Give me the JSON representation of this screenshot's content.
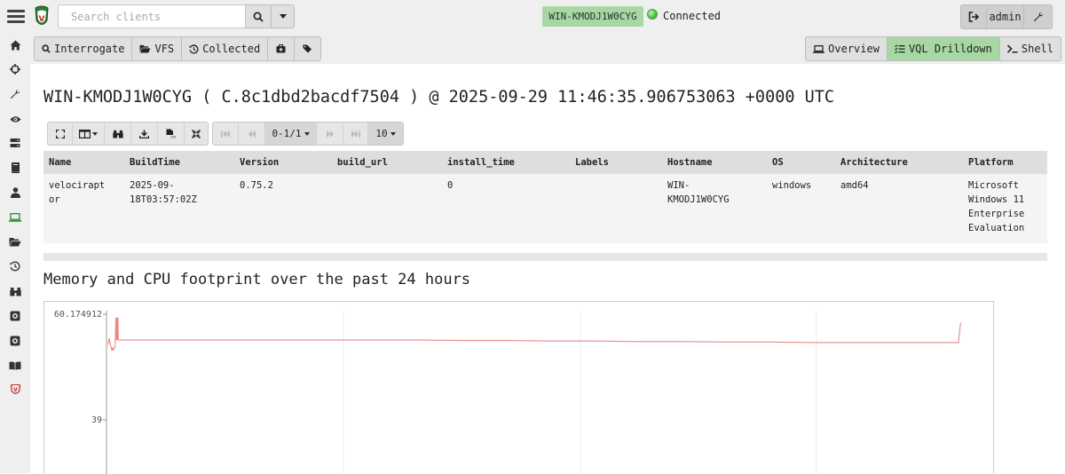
{
  "topbar": {
    "search_placeholder": "Search clients",
    "client_badge": "WIN-KMODJ1W0CYG",
    "connection_status": "Connected",
    "user": "admin"
  },
  "toolbar": {
    "interrogate": "Interrogate",
    "vfs": "VFS",
    "collected": "Collected",
    "overview": "Overview",
    "vql_drilldown": "VQL Drilldown",
    "shell": "Shell"
  },
  "sidebar_icons": [
    "home-icon",
    "crosshair-icon",
    "wrench-icon",
    "eye-icon",
    "server-icon",
    "book-icon",
    "user-icon",
    "laptop-icon",
    "folder-open-icon",
    "history-icon",
    "binoculars-icon",
    "box-icon",
    "box-icon",
    "book-open-icon",
    "velociraptor-icon"
  ],
  "main": {
    "title": "WIN-KMODJ1W0CYG ( C.8c1dbd2bacdf7504 ) @ 2025-09-29 11:46:35.906753063 +0000 UTC",
    "pager_label": "0-1/1",
    "page_size": "10",
    "table": {
      "columns": [
        "Name",
        "BuildTime",
        "Version",
        "build_url",
        "install_time",
        "Labels",
        "Hostname",
        "OS",
        "Architecture",
        "Platform"
      ],
      "rows": [
        {
          "Name": "velocirapt\nor",
          "BuildTime": "2025-09-\n18T03:57:02Z",
          "Version": "0.75.2",
          "build_url": "",
          "install_time": "0",
          "Labels": "",
          "Hostname": "WIN-\nKMODJ1W0CYG",
          "OS": "windows",
          "Architecture": "amd64",
          "Platform": "Microsoft\nWindows 11\nEnterprise\nEvaluation"
        }
      ]
    },
    "section_title": "Memory and CPU footprint over the past 24 hours"
  },
  "chart_data": {
    "type": "line",
    "title": "",
    "xlabel": "",
    "ylabel": "",
    "y_ticks": [
      "60.174912",
      "39"
    ],
    "ylim": [
      15,
      60.174912
    ],
    "series": [
      {
        "color": "#e88a8a",
        "x": [
          0,
          0.3,
          1,
          1.6,
          2.2,
          2.8,
          3.5,
          4.0,
          4.5,
          5.0,
          5.6,
          6.2,
          7.0,
          7.8,
          8.2,
          8.6,
          8.9,
          9.2,
          9.5,
          9.8,
          10.1,
          10.4,
          10.7,
          11.0,
          11.3,
          11.6,
          12.0,
          14,
          20,
          30,
          50,
          70,
          100,
          150,
          200,
          250,
          300,
          350,
          400,
          450,
          500,
          550,
          600,
          650,
          700,
          750,
          800,
          850,
          900,
          940,
          960,
          962,
          963
        ],
        "y": [
          54,
          54.8,
          55.2,
          54.9,
          54.4,
          53.9,
          53.3,
          52.9,
          53.2,
          53.4,
          53.0,
          53.2,
          53.3,
          54.0,
          57.0,
          59.5,
          55.0,
          59.5,
          55.0,
          59.5,
          55.0,
          59.5,
          55.0,
          59.5,
          55.2,
          55.0,
          55.0,
          55.0,
          55.0,
          55.0,
          55.0,
          55.0,
          55.0,
          55.0,
          55.0,
          55.0,
          55.0,
          55.0,
          54.9,
          54.9,
          54.8,
          54.8,
          54.7,
          54.7,
          54.6,
          54.6,
          54.5,
          54.5,
          54.5,
          54.5,
          54.5,
          58.0,
          58.5
        ]
      }
    ],
    "grid": true
  }
}
